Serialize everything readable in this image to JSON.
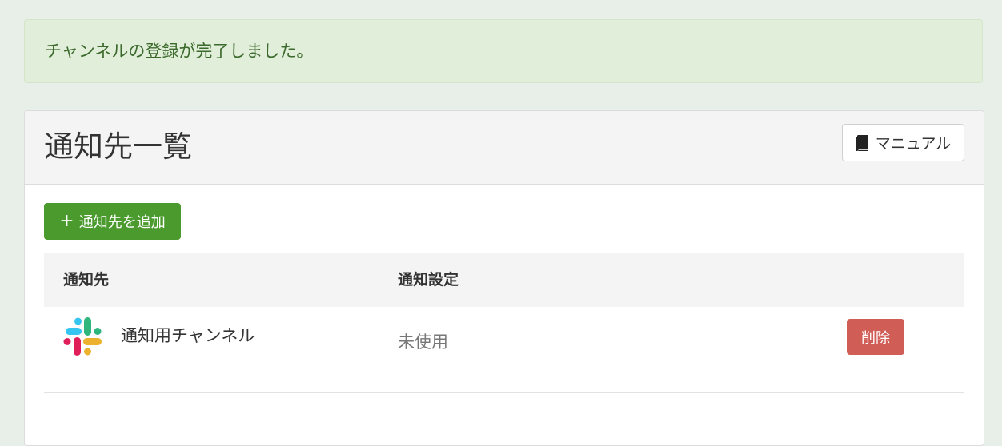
{
  "alert": {
    "message": "チャンネルの登録が完了しました。"
  },
  "panel": {
    "title": "通知先一覧",
    "manual_button": {
      "icon": "book-icon",
      "label": "マニュアル"
    },
    "add_button": {
      "icon": "plus-icon",
      "label": "通知先を追加"
    }
  },
  "table": {
    "columns": [
      "通知先",
      "通知設定",
      ""
    ],
    "rows": [
      {
        "icon": "slack-icon",
        "name": "通知用チャンネル",
        "setting": "未使用",
        "delete_label": "削除"
      }
    ]
  },
  "colors": {
    "page_background": "#e8efe9",
    "alert_background": "#e1eed9",
    "alert_text": "#3c6a2d",
    "add_button": "#4b9a2e",
    "delete_button": "#d15d57",
    "header_background": "#f4f4f4"
  }
}
